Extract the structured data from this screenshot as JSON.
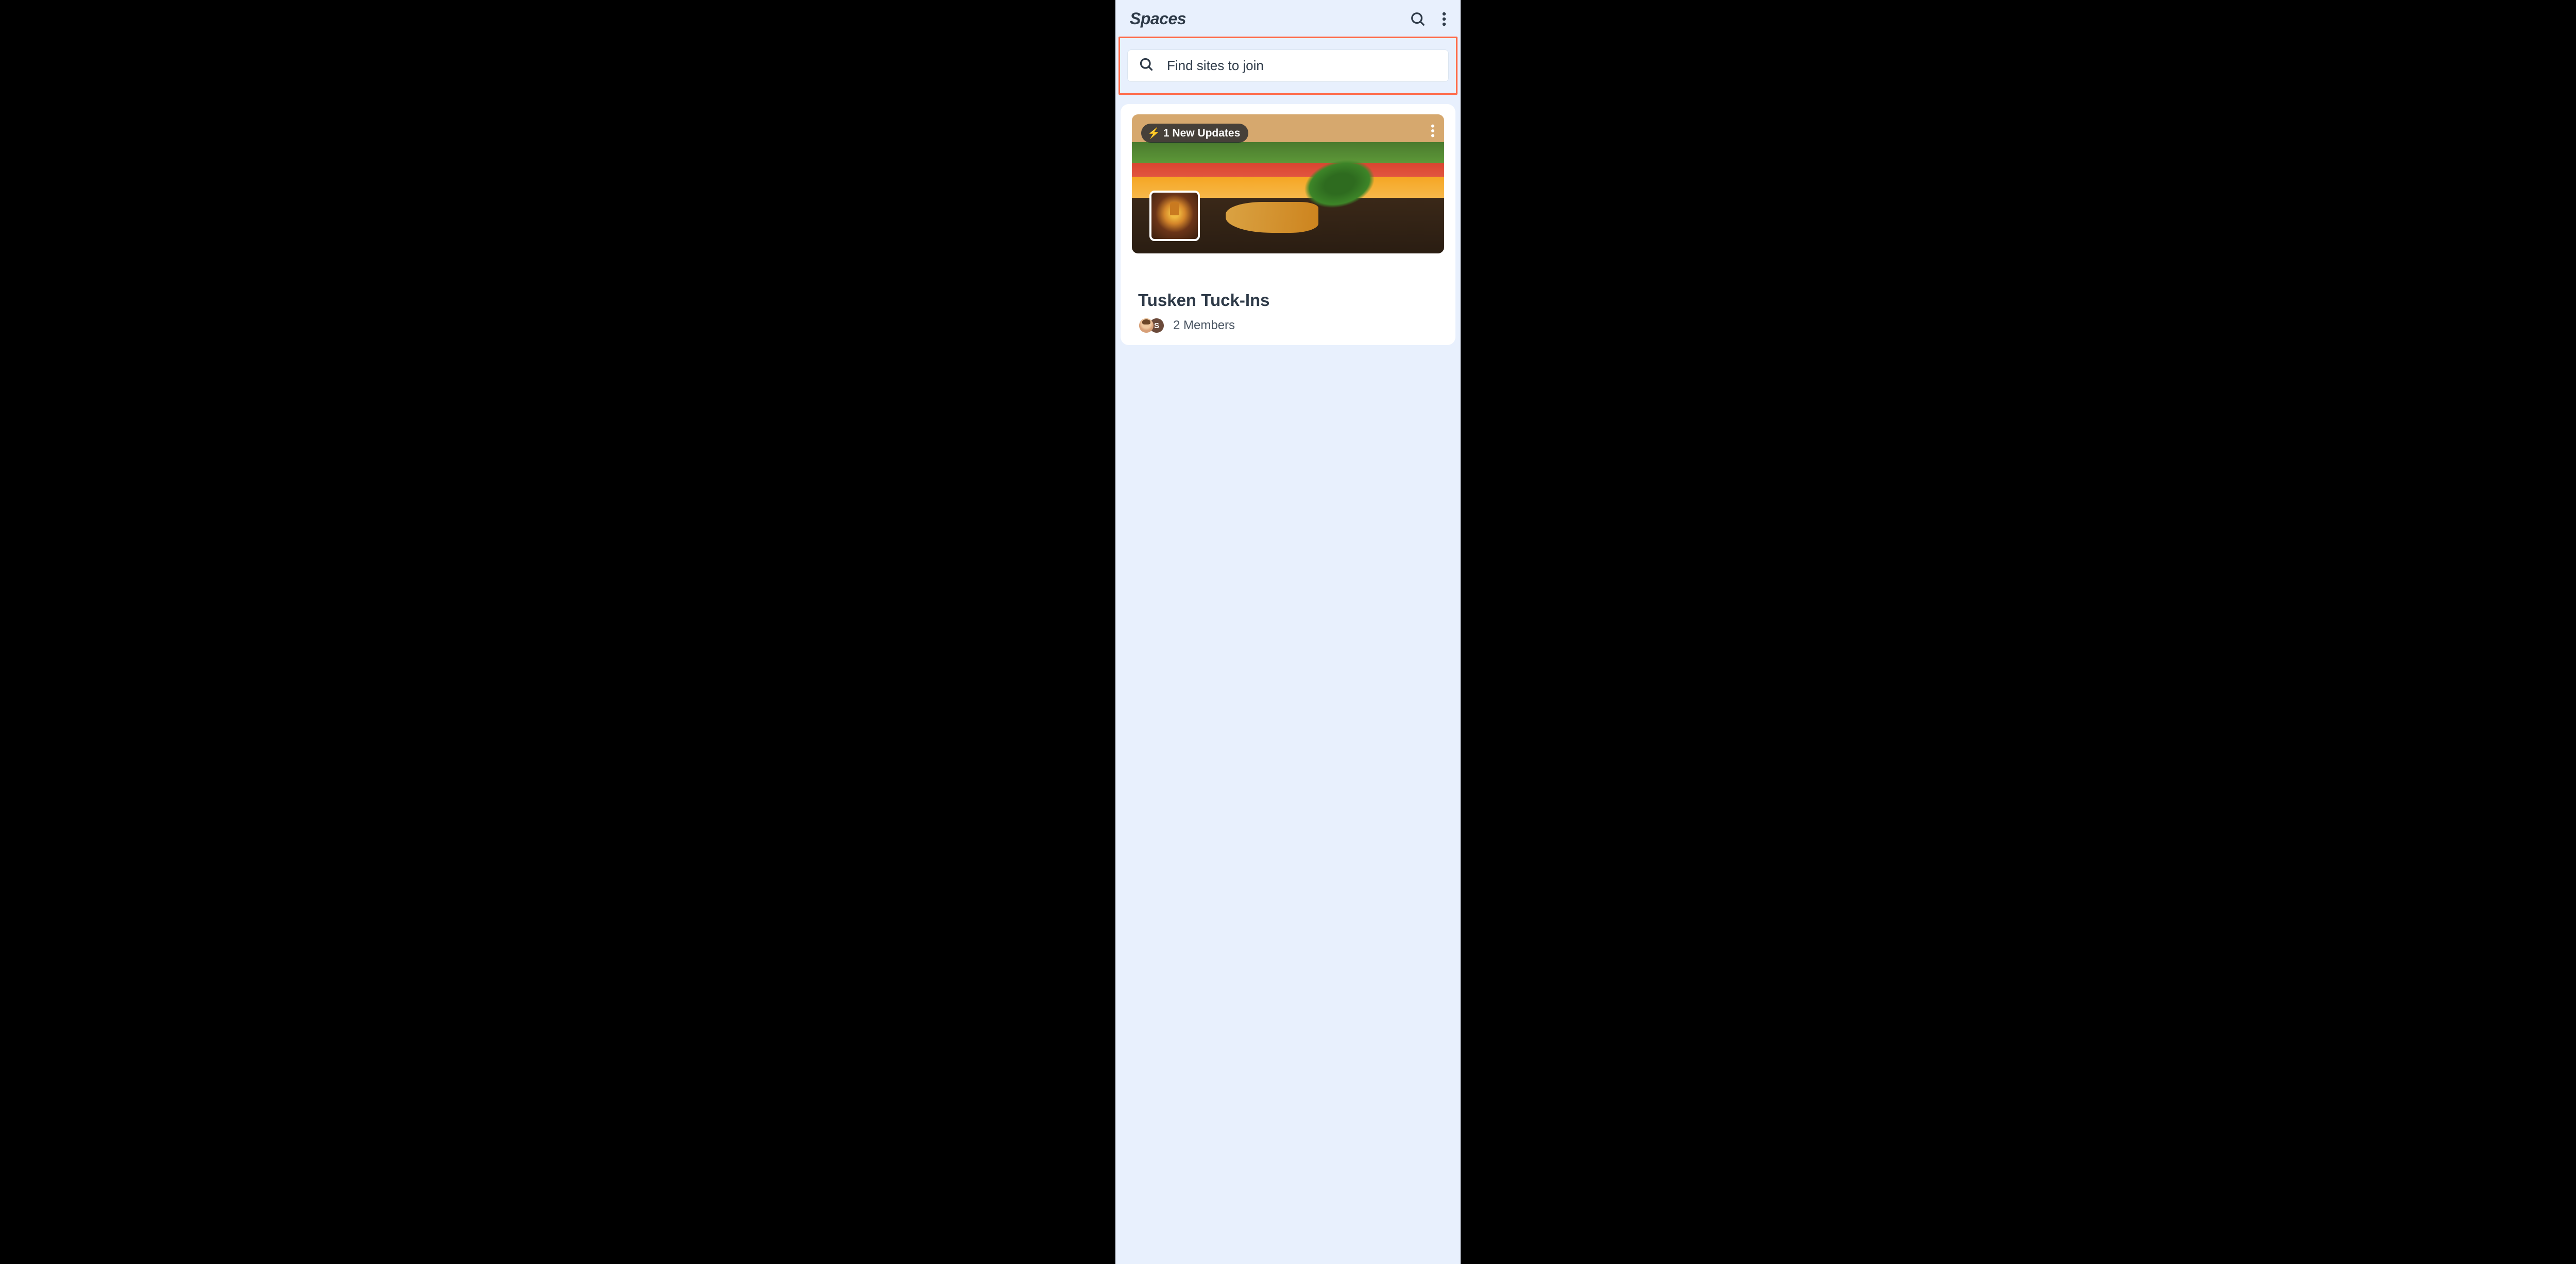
{
  "header": {
    "title": "Spaces"
  },
  "search": {
    "placeholder": "Find sites to join"
  },
  "card": {
    "updates_badge": "1 New Updates",
    "title": "Tusken Tuck-Ins",
    "members_text": "2 Members",
    "avatar_letter": "S"
  },
  "icons": {
    "bolt": "⚡"
  },
  "colors": {
    "highlight_border": "#ff6b4a",
    "background": "#e8f0fd",
    "text_primary": "#2e3a48"
  }
}
